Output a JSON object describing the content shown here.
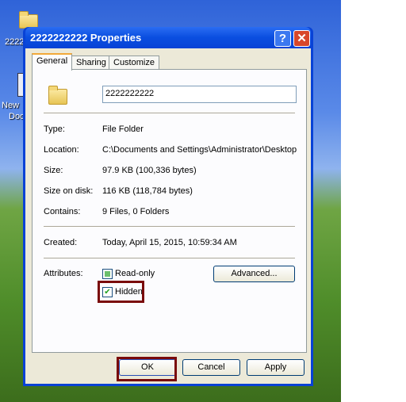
{
  "desktop": {
    "icons": [
      {
        "label": "2222"
      },
      {
        "label": "New",
        "label2": "Doc"
      }
    ]
  },
  "dialog": {
    "title": "2222222222 Properties",
    "tabs": [
      {
        "label": "General",
        "active": true
      },
      {
        "label": "Sharing"
      },
      {
        "label": "Customize"
      }
    ],
    "name_value": "2222222222",
    "properties": [
      {
        "label": "Type:",
        "value": "File Folder"
      },
      {
        "label": "Location:",
        "value": "C:\\Documents and Settings\\Administrator\\Desktop"
      },
      {
        "label": "Size:",
        "value": "97.9 KB (100,336 bytes)"
      },
      {
        "label": "Size on disk:",
        "value": "116 KB (118,784 bytes)"
      },
      {
        "label": "Contains:",
        "value": "9 Files, 0 Folders"
      },
      {
        "label": "Created:",
        "value": "Today, April 15, 2015, 10:59:34 AM"
      }
    ],
    "attributes_label": "Attributes:",
    "readonly": {
      "label": "Read-only",
      "state": "indeterminate"
    },
    "hidden": {
      "label": "Hidden",
      "checked": true
    },
    "advanced_label": "Advanced...",
    "ok_label": "OK",
    "cancel_label": "Cancel",
    "apply_label": "Apply",
    "help_glyph": "?",
    "close_glyph": "✕",
    "check_glyph": "✔"
  },
  "colors": {
    "highlight": "#7a0a0a",
    "titlebar": "#0842d6"
  }
}
